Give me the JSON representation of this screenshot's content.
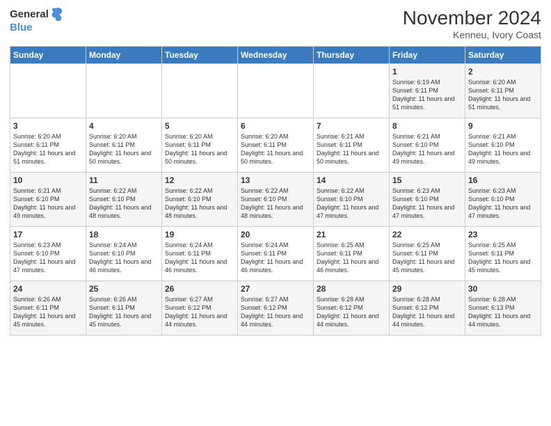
{
  "logo": {
    "general": "General",
    "blue": "Blue"
  },
  "title": "November 2024",
  "location": "Kenneu, Ivory Coast",
  "days_header": [
    "Sunday",
    "Monday",
    "Tuesday",
    "Wednesday",
    "Thursday",
    "Friday",
    "Saturday"
  ],
  "weeks": [
    [
      {
        "day": "",
        "info": ""
      },
      {
        "day": "",
        "info": ""
      },
      {
        "day": "",
        "info": ""
      },
      {
        "day": "",
        "info": ""
      },
      {
        "day": "",
        "info": ""
      },
      {
        "day": "1",
        "info": "Sunrise: 6:19 AM\nSunset: 6:11 PM\nDaylight: 11 hours and 51 minutes."
      },
      {
        "day": "2",
        "info": "Sunrise: 6:20 AM\nSunset: 6:11 PM\nDaylight: 11 hours and 51 minutes."
      }
    ],
    [
      {
        "day": "3",
        "info": "Sunrise: 6:20 AM\nSunset: 6:11 PM\nDaylight: 11 hours and 51 minutes."
      },
      {
        "day": "4",
        "info": "Sunrise: 6:20 AM\nSunset: 6:11 PM\nDaylight: 11 hours and 50 minutes."
      },
      {
        "day": "5",
        "info": "Sunrise: 6:20 AM\nSunset: 6:11 PM\nDaylight: 11 hours and 50 minutes."
      },
      {
        "day": "6",
        "info": "Sunrise: 6:20 AM\nSunset: 6:11 PM\nDaylight: 11 hours and 50 minutes."
      },
      {
        "day": "7",
        "info": "Sunrise: 6:21 AM\nSunset: 6:11 PM\nDaylight: 11 hours and 50 minutes."
      },
      {
        "day": "8",
        "info": "Sunrise: 6:21 AM\nSunset: 6:10 PM\nDaylight: 11 hours and 49 minutes."
      },
      {
        "day": "9",
        "info": "Sunrise: 6:21 AM\nSunset: 6:10 PM\nDaylight: 11 hours and 49 minutes."
      }
    ],
    [
      {
        "day": "10",
        "info": "Sunrise: 6:21 AM\nSunset: 6:10 PM\nDaylight: 11 hours and 49 minutes."
      },
      {
        "day": "11",
        "info": "Sunrise: 6:22 AM\nSunset: 6:10 PM\nDaylight: 11 hours and 48 minutes."
      },
      {
        "day": "12",
        "info": "Sunrise: 6:22 AM\nSunset: 6:10 PM\nDaylight: 11 hours and 48 minutes."
      },
      {
        "day": "13",
        "info": "Sunrise: 6:22 AM\nSunset: 6:10 PM\nDaylight: 11 hours and 48 minutes."
      },
      {
        "day": "14",
        "info": "Sunrise: 6:22 AM\nSunset: 6:10 PM\nDaylight: 11 hours and 47 minutes."
      },
      {
        "day": "15",
        "info": "Sunrise: 6:23 AM\nSunset: 6:10 PM\nDaylight: 11 hours and 47 minutes."
      },
      {
        "day": "16",
        "info": "Sunrise: 6:23 AM\nSunset: 6:10 PM\nDaylight: 11 hours and 47 minutes."
      }
    ],
    [
      {
        "day": "17",
        "info": "Sunrise: 6:23 AM\nSunset: 6:10 PM\nDaylight: 11 hours and 47 minutes."
      },
      {
        "day": "18",
        "info": "Sunrise: 6:24 AM\nSunset: 6:10 PM\nDaylight: 11 hours and 46 minutes."
      },
      {
        "day": "19",
        "info": "Sunrise: 6:24 AM\nSunset: 6:11 PM\nDaylight: 11 hours and 46 minutes."
      },
      {
        "day": "20",
        "info": "Sunrise: 6:24 AM\nSunset: 6:11 PM\nDaylight: 11 hours and 46 minutes."
      },
      {
        "day": "21",
        "info": "Sunrise: 6:25 AM\nSunset: 6:11 PM\nDaylight: 11 hours and 46 minutes."
      },
      {
        "day": "22",
        "info": "Sunrise: 6:25 AM\nSunset: 6:11 PM\nDaylight: 11 hours and 45 minutes."
      },
      {
        "day": "23",
        "info": "Sunrise: 6:25 AM\nSunset: 6:11 PM\nDaylight: 11 hours and 45 minutes."
      }
    ],
    [
      {
        "day": "24",
        "info": "Sunrise: 6:26 AM\nSunset: 6:11 PM\nDaylight: 11 hours and 45 minutes."
      },
      {
        "day": "25",
        "info": "Sunrise: 6:26 AM\nSunset: 6:11 PM\nDaylight: 11 hours and 45 minutes."
      },
      {
        "day": "26",
        "info": "Sunrise: 6:27 AM\nSunset: 6:12 PM\nDaylight: 11 hours and 44 minutes."
      },
      {
        "day": "27",
        "info": "Sunrise: 6:27 AM\nSunset: 6:12 PM\nDaylight: 11 hours and 44 minutes."
      },
      {
        "day": "28",
        "info": "Sunrise: 6:28 AM\nSunset: 6:12 PM\nDaylight: 11 hours and 44 minutes."
      },
      {
        "day": "29",
        "info": "Sunrise: 6:28 AM\nSunset: 6:12 PM\nDaylight: 11 hours and 44 minutes."
      },
      {
        "day": "30",
        "info": "Sunrise: 6:28 AM\nSunset: 6:13 PM\nDaylight: 11 hours and 44 minutes."
      }
    ]
  ]
}
